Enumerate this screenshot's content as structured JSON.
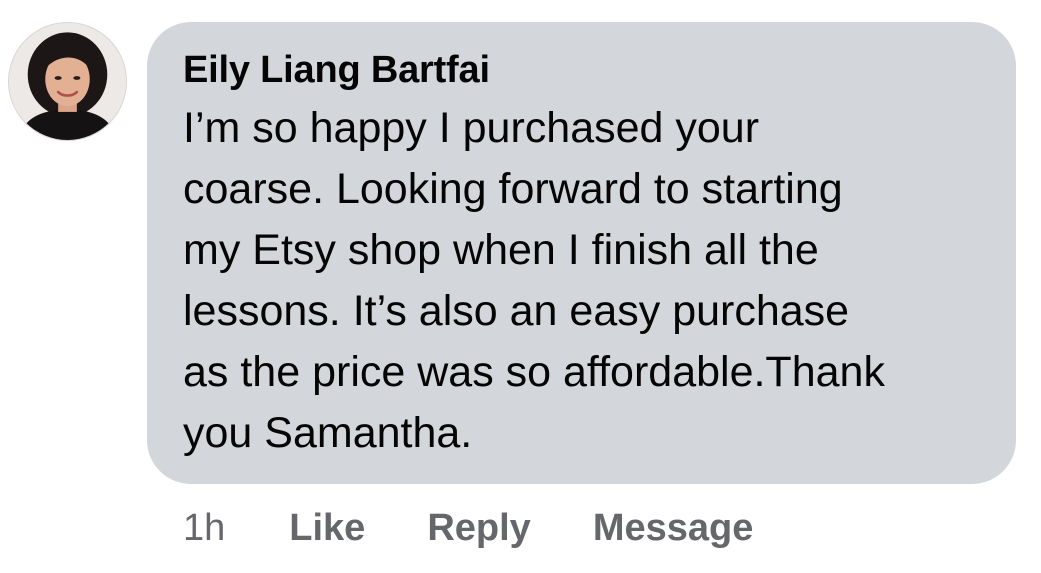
{
  "comment": {
    "author": "Eily Liang Bartfai",
    "text": "I’m so happy I purchased your\ncoarse. Looking forward to starting\nmy Etsy shop when I finish all the\nlessons. It’s also an easy purchase\nas the price was so affordable.Thank\nyou Samantha.",
    "avatar_icon": "profile-photo-icon",
    "bubble_color": "#d3d6da"
  },
  "actions": {
    "timestamp": "1h",
    "like_label": "Like",
    "reply_label": "Reply",
    "message_label": "Message",
    "color": "#65676b"
  }
}
